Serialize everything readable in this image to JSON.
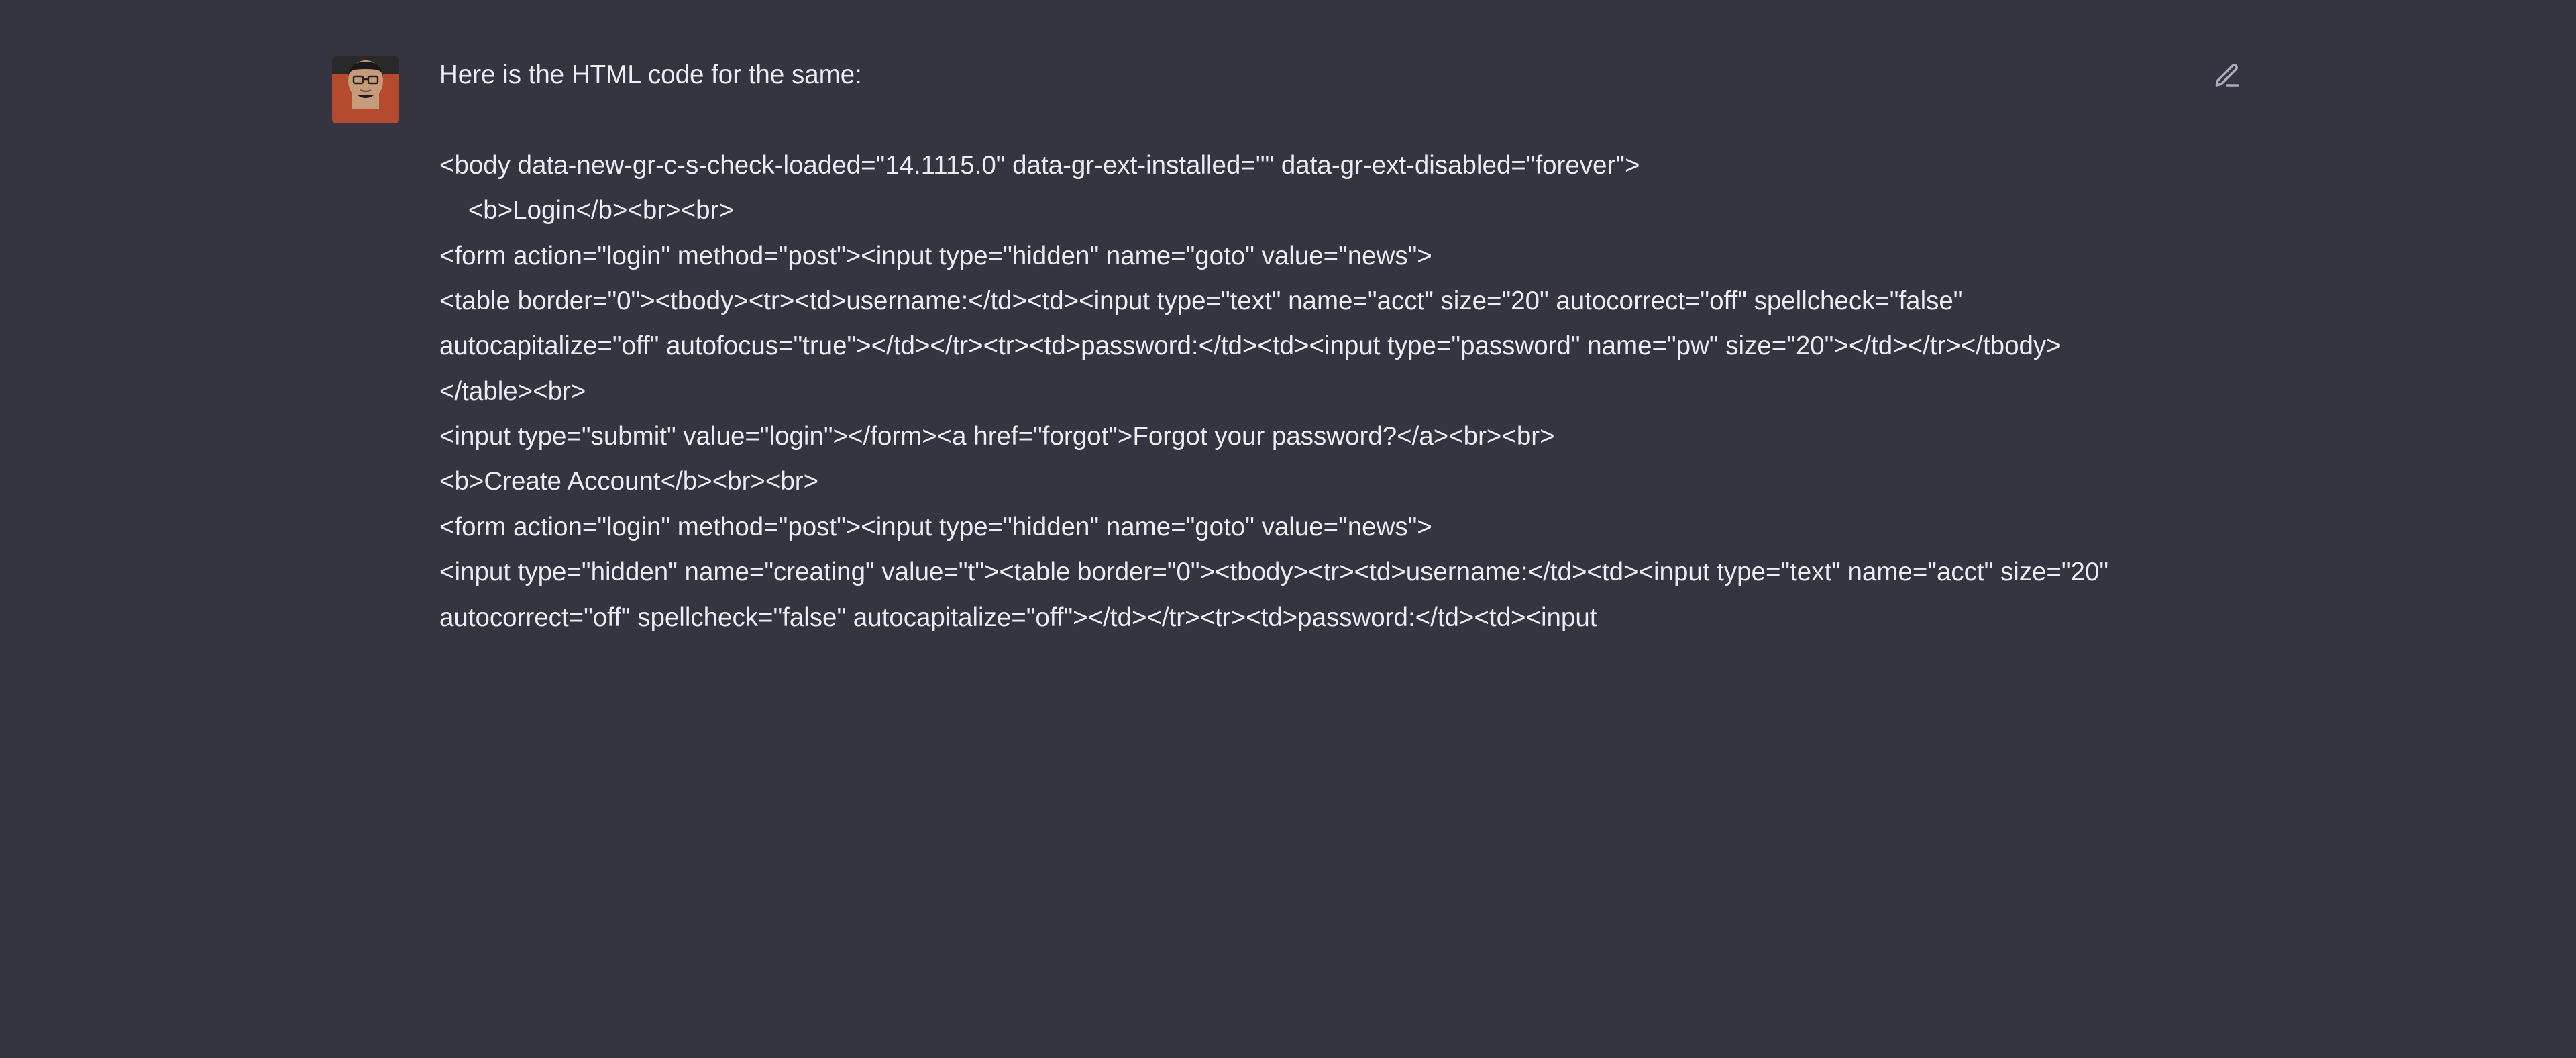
{
  "message": {
    "intro": "Here is the HTML code for the same:",
    "code_lines": [
      "<body data-new-gr-c-s-check-loaded=\"14.1115.0\" data-gr-ext-installed=\"\" data-gr-ext-disabled=\"forever\">",
      "    <b>Login</b><br><br>",
      "<form action=\"login\" method=\"post\"><input type=\"hidden\" name=\"goto\" value=\"news\">",
      "<table border=\"0\"><tbody><tr><td>username:</td><td><input type=\"text\" name=\"acct\" size=\"20\" autocorrect=\"off\" spellcheck=\"false\" autocapitalize=\"off\" autofocus=\"true\"></td></tr><tr><td>password:</td><td><input type=\"password\" name=\"pw\" size=\"20\"></td></tr></tbody></table><br>",
      "<input type=\"submit\" value=\"login\"></form><a href=\"forgot\">Forgot your password?</a><br><br>",
      "<b>Create Account</b><br><br>",
      "<form action=\"login\" method=\"post\"><input type=\"hidden\" name=\"goto\" value=\"news\">",
      "<input type=\"hidden\" name=\"creating\" value=\"t\"><table border=\"0\"><tbody><tr><td>username:</td><td><input type=\"text\" name=\"acct\" size=\"20\" autocorrect=\"off\" spellcheck=\"false\" autocapitalize=\"off\"></td></tr><tr><td>password:</td><td><input"
    ]
  },
  "icons": {
    "edit": "edit-icon"
  }
}
